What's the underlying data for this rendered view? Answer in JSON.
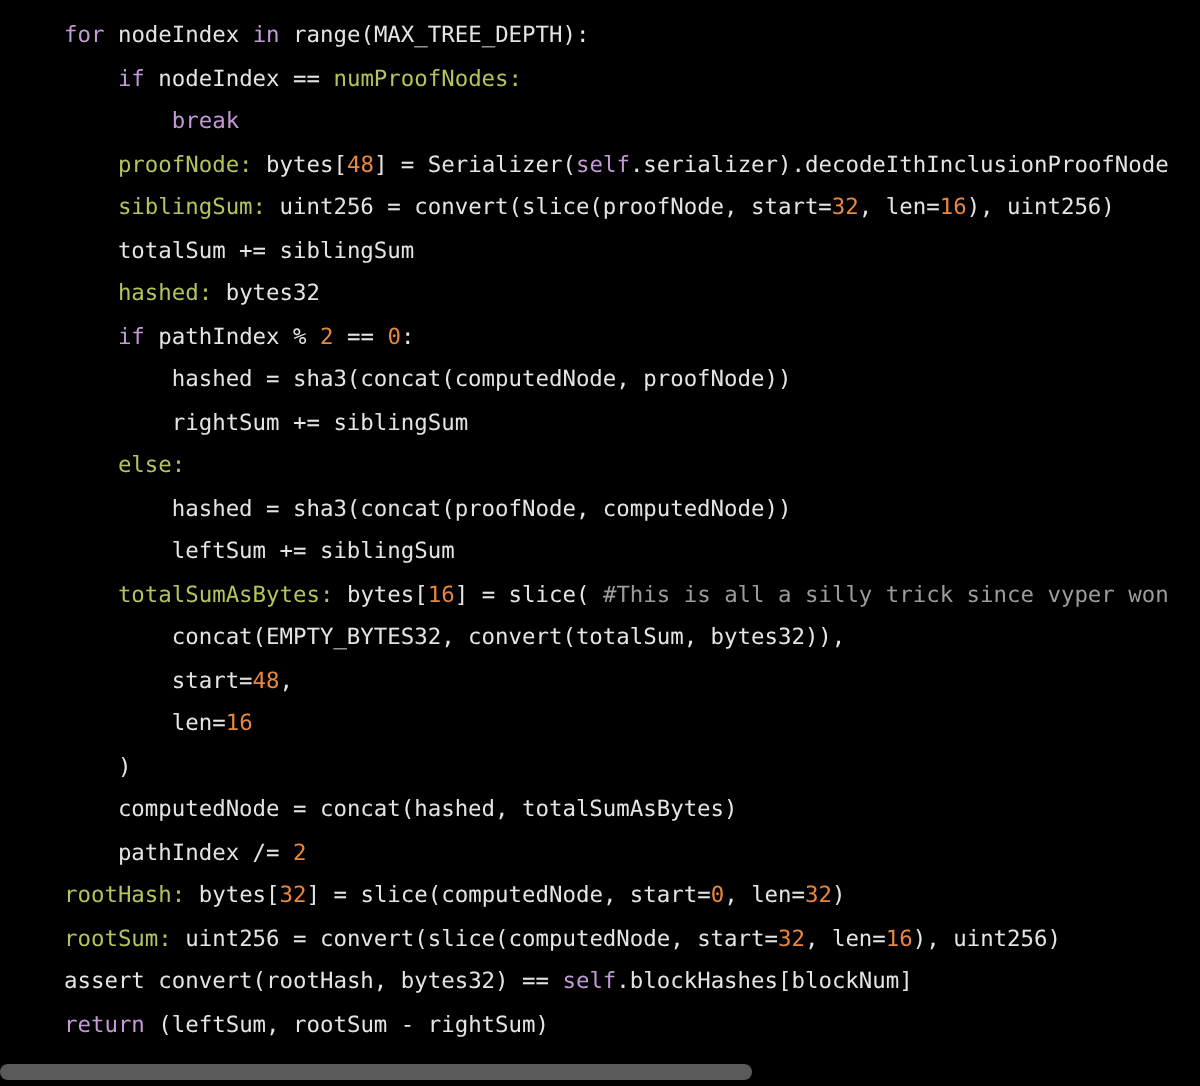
{
  "code_lines": [
    {
      "tokens": [
        {
          "kind": "keyword",
          "text": "for"
        },
        {
          "kind": "plain",
          "text": " nodeIndex "
        },
        {
          "kind": "keyword",
          "text": "in"
        },
        {
          "kind": "plain",
          "text": " range(MAX_TREE_DEPTH):"
        }
      ],
      "children": [
        {
          "tokens": [
            {
              "kind": "keyword",
              "text": "if"
            },
            {
              "kind": "plain",
              "text": " nodeIndex == "
            },
            {
              "kind": "name",
              "text": "numProofNodes:"
            }
          ],
          "children": [
            {
              "tokens": [
                {
                  "kind": "keyword",
                  "text": "break"
                }
              ]
            }
          ]
        },
        {
          "tokens": [
            {
              "kind": "name",
              "text": "proofNode:"
            },
            {
              "kind": "plain",
              "text": " bytes["
            },
            {
              "kind": "number",
              "text": "48"
            },
            {
              "kind": "plain",
              "text": "] = Serializer("
            },
            {
              "kind": "keyword",
              "text": "self"
            },
            {
              "kind": "plain",
              "text": ".serializer).decodeIthInclusionProofNode"
            }
          ]
        },
        {
          "tokens": [
            {
              "kind": "name",
              "text": "siblingSum:"
            },
            {
              "kind": "plain",
              "text": " uint256 = convert(slice(proofNode, start="
            },
            {
              "kind": "number",
              "text": "32"
            },
            {
              "kind": "plain",
              "text": ", len="
            },
            {
              "kind": "number",
              "text": "16"
            },
            {
              "kind": "plain",
              "text": "), uint256)"
            }
          ]
        },
        {
          "tokens": [
            {
              "kind": "plain",
              "text": "totalSum += siblingSum"
            }
          ]
        },
        {
          "tokens": [
            {
              "kind": "name",
              "text": "hashed:"
            },
            {
              "kind": "plain",
              "text": " bytes32"
            }
          ]
        },
        {
          "tokens": [
            {
              "kind": "keyword",
              "text": "if"
            },
            {
              "kind": "plain",
              "text": " pathIndex % "
            },
            {
              "kind": "number",
              "text": "2"
            },
            {
              "kind": "plain",
              "text": " == "
            },
            {
              "kind": "number",
              "text": "0"
            },
            {
              "kind": "plain",
              "text": ":"
            }
          ],
          "children": [
            {
              "tokens": [
                {
                  "kind": "plain",
                  "text": "hashed = sha3(concat(computedNode, proofNode))"
                }
              ]
            },
            {
              "tokens": [
                {
                  "kind": "plain",
                  "text": "rightSum += siblingSum"
                }
              ]
            }
          ]
        },
        {
          "tokens": [
            {
              "kind": "name",
              "text": "else:"
            }
          ],
          "children": [
            {
              "tokens": [
                {
                  "kind": "plain",
                  "text": "hashed = sha3(concat(proofNode, computedNode))"
                }
              ]
            },
            {
              "tokens": [
                {
                  "kind": "plain",
                  "text": "leftSum += siblingSum"
                }
              ]
            }
          ]
        },
        {
          "tokens": [
            {
              "kind": "name",
              "text": "totalSumAsBytes:"
            },
            {
              "kind": "plain",
              "text": " bytes["
            },
            {
              "kind": "number",
              "text": "16"
            },
            {
              "kind": "plain",
              "text": "] = slice( "
            },
            {
              "kind": "comment",
              "text": "#This is all a silly trick since vyper won"
            }
          ],
          "children": [
            {
              "tokens": [
                {
                  "kind": "plain",
                  "text": "concat(EMPTY_BYTES32, convert(totalSum, bytes32)),"
                }
              ]
            },
            {
              "tokens": [
                {
                  "kind": "plain",
                  "text": "start="
                },
                {
                  "kind": "number",
                  "text": "48"
                },
                {
                  "kind": "plain",
                  "text": ","
                }
              ]
            },
            {
              "tokens": [
                {
                  "kind": "plain",
                  "text": "len="
                },
                {
                  "kind": "number",
                  "text": "16"
                }
              ]
            }
          ]
        },
        {
          "tokens": [
            {
              "kind": "plain",
              "text": ")"
            }
          ]
        },
        {
          "tokens": [
            {
              "kind": "plain",
              "text": "computedNode = concat(hashed, totalSumAsBytes)"
            }
          ]
        },
        {
          "tokens": [
            {
              "kind": "plain",
              "text": "pathIndex /= "
            },
            {
              "kind": "number",
              "text": "2"
            }
          ]
        }
      ]
    },
    {
      "tokens": [
        {
          "kind": "name",
          "text": "rootHash:"
        },
        {
          "kind": "plain",
          "text": " bytes["
        },
        {
          "kind": "number",
          "text": "32"
        },
        {
          "kind": "plain",
          "text": "] = slice(computedNode, start="
        },
        {
          "kind": "number",
          "text": "0"
        },
        {
          "kind": "plain",
          "text": ", len="
        },
        {
          "kind": "number",
          "text": "32"
        },
        {
          "kind": "plain",
          "text": ")"
        }
      ]
    },
    {
      "tokens": [
        {
          "kind": "name",
          "text": "rootSum:"
        },
        {
          "kind": "plain",
          "text": " uint256 = convert(slice(computedNode, start="
        },
        {
          "kind": "number",
          "text": "32"
        },
        {
          "kind": "plain",
          "text": ", len="
        },
        {
          "kind": "number",
          "text": "16"
        },
        {
          "kind": "plain",
          "text": "), uint256)"
        }
      ]
    },
    {
      "tokens": [
        {
          "kind": "plain",
          "text": "assert convert(rootHash, bytes32) == "
        },
        {
          "kind": "keyword",
          "text": "self"
        },
        {
          "kind": "plain",
          "text": ".blockHashes[blockNum]"
        }
      ]
    },
    {
      "tokens": [
        {
          "kind": "keyword",
          "text": "return"
        },
        {
          "kind": "plain",
          "text": " (leftSum, rootSum - rightSum)"
        }
      ]
    }
  ]
}
